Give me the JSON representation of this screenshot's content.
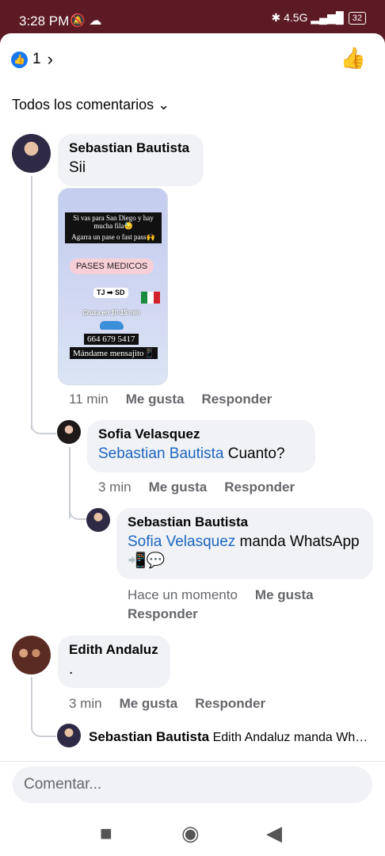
{
  "status": {
    "time": "3:28 PM",
    "icons_left": "🔕 ☁",
    "icons_right": "✱ 4.5G ▂▄▆█",
    "battery": "32"
  },
  "header": {
    "like_count": "1",
    "chevron": "›",
    "like_icon": "thumbs-up-outline-icon"
  },
  "filter": {
    "label": "Todos los comentarios",
    "chevron": "⌄"
  },
  "comments": [
    {
      "name": "Sebastian Bautista",
      "text": "Sii",
      "time": "11 min",
      "like": "Me gusta",
      "reply": "Responder"
    },
    {
      "name": "Sofia Velasquez",
      "mention": "Sebastian Bautista",
      "text": "Cuanto?",
      "time": "3 min",
      "like": "Me gusta",
      "reply": "Responder"
    },
    {
      "name": "Sebastian Bautista",
      "mention": "Sofia Velasquez",
      "text": "manda WhatsApp📲💬",
      "time": "Hace un momento",
      "like": "Me gusta",
      "reply": "Responder"
    },
    {
      "name": "Edith Andaluz",
      "text": ".",
      "time": "3 min",
      "like": "Me gusta",
      "reply": "Responder"
    }
  ],
  "image_post": {
    "line1": "Si vas para San Diego y hay mucha fila😓",
    "line2": "Agarra un pase o fast pass🙌",
    "pill": "PASES MEDICOS",
    "route": "TJ ➡ SD",
    "cross": "Cruza en 10-15 min",
    "phone": "664 679 5417",
    "cta": "Mándame mensajito📱"
  },
  "inline_reply": {
    "name": "Sebastian Bautista",
    "text": "Edith Andaluz manda What..."
  },
  "composer": {
    "placeholder": "Comentar..."
  },
  "nav": {
    "square": "■",
    "home": "◉",
    "back": "◀"
  }
}
